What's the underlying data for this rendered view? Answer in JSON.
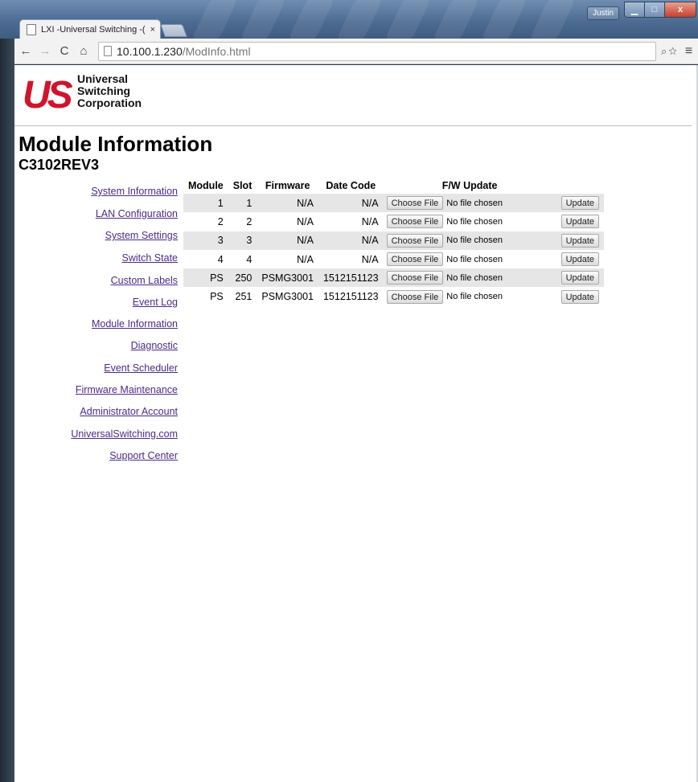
{
  "browser": {
    "tab_title": "LXI -Universal Switching -(",
    "tab_close": "×",
    "url_host": "10.100.1.230",
    "url_path": "/ModInfo.html",
    "user": "Justin",
    "icons": [
      "back-icon",
      "forward-icon",
      "reload-icon",
      "home-icon",
      "zoom-icon",
      "star-icon",
      "menu-icon"
    ]
  },
  "logo": {
    "mark": "US",
    "line1": "Universal",
    "line2": "Switching",
    "line3": "Corporation"
  },
  "page": {
    "title": "Module Information",
    "subtitle": "C3102REV3"
  },
  "sidebar": {
    "items": [
      {
        "label": "System Information"
      },
      {
        "label": "LAN Configuration"
      },
      {
        "label": "System Settings"
      },
      {
        "label": "Switch State"
      },
      {
        "label": "Custom Labels"
      },
      {
        "label": "Event Log"
      },
      {
        "label": "Module Information"
      },
      {
        "label": "Diagnostic"
      },
      {
        "label": "Event Scheduler"
      },
      {
        "label": "Firmware Maintenance"
      },
      {
        "label": "Administrator Account"
      },
      {
        "label": "UniversalSwitching.com"
      },
      {
        "label": "Support Center"
      }
    ]
  },
  "table": {
    "headers": [
      "Module",
      "Slot",
      "Firmware",
      "Date Code",
      "F/W Update"
    ],
    "choose_label": "Choose File",
    "no_file": "No file chosen",
    "update_label": "Update",
    "rows": [
      {
        "module": "1",
        "slot": "1",
        "firmware": "N/A",
        "date_code": "N/A"
      },
      {
        "module": "2",
        "slot": "2",
        "firmware": "N/A",
        "date_code": "N/A"
      },
      {
        "module": "3",
        "slot": "3",
        "firmware": "N/A",
        "date_code": "N/A"
      },
      {
        "module": "4",
        "slot": "4",
        "firmware": "N/A",
        "date_code": "N/A"
      },
      {
        "module": "PS",
        "slot": "250",
        "firmware": "PSMG3001",
        "date_code": "1512151123"
      },
      {
        "module": "PS",
        "slot": "251",
        "firmware": "PSMG3001",
        "date_code": "1512151123"
      }
    ]
  },
  "colors": {
    "logo_red": "#d0142c",
    "link": "#4b2a8a",
    "row_shade": "#e6e6e6"
  }
}
